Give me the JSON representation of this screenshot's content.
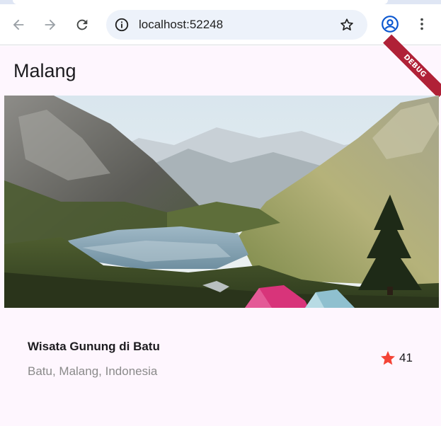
{
  "browser": {
    "url": "localhost:52248",
    "icons": {
      "back": "arrow-back-icon",
      "forward": "arrow-forward-icon",
      "reload": "reload-icon",
      "site_info": "site-info-icon",
      "bookmark": "star-outline-icon",
      "profile": "account-circle-icon",
      "menu": "more-vert-icon"
    }
  },
  "app": {
    "title": "Malang",
    "debug_label": "DEBUG",
    "hero_image": "mountain-lake-valley-with-tents",
    "place": {
      "title": "Wisata Gunung di Batu",
      "subtitle": "Batu, Malang, Indonesia"
    },
    "rating": {
      "icon": "star-icon",
      "count": "41",
      "color": "#f44336"
    },
    "colors": {
      "background": "#fef6fe",
      "debug_banner": "#b02137"
    }
  }
}
